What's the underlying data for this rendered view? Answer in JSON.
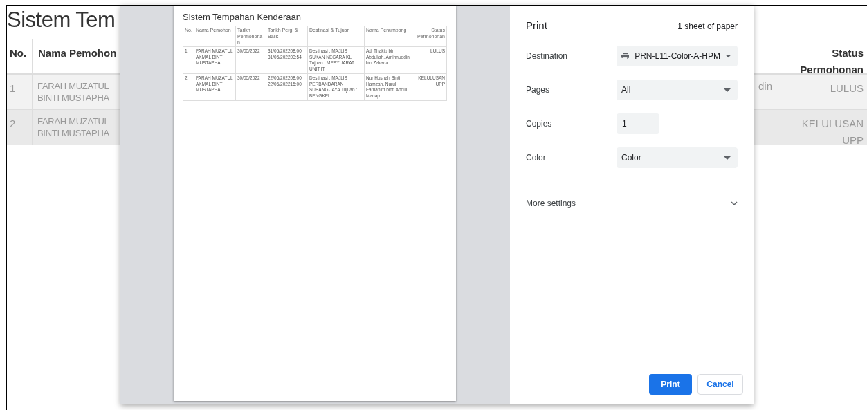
{
  "background": {
    "title": "Sistem Tem",
    "columns": [
      "No.",
      "Nama Pemohon",
      "Status Permohonan"
    ],
    "rows": [
      {
        "no": "1",
        "name": [
          "FARAH MUZATUL",
          "BINTI MUSTAPHA"
        ],
        "passenger": "din",
        "status": "LULUS"
      },
      {
        "no": "2",
        "name": [
          "FARAH MUZATUL",
          "BINTI MUSTAPHA"
        ],
        "status": "KELULUSAN UPP"
      }
    ]
  },
  "preview": {
    "title": "Sistem Tempahan Kenderaan",
    "columns": [
      "No.",
      "Nama Pemohon",
      "Tarikh Permohonan",
      "Tarikh Pergi & Balik",
      "Destinasi & Tujuan",
      "Nama Penumpang",
      "Status Permohonan"
    ],
    "rows": [
      [
        "1",
        "FARAH MUZATUL AKMAL BINTI MUSTAPHA",
        "30/05/2022",
        "31/05/202208:00 31/05/202203:54",
        "Destinasi : MAJLIS SUKAN NEGARA KL Tujuan : MESYUARAT UNIT IT",
        "Adi Thakib bin Abdullah, Aminnuddin bin Zakaria",
        "LULUS"
      ],
      [
        "2",
        "FARAH MUZATUL AKMAL BINTI MUSTAPHA",
        "30/05/2022",
        "22/06/202208:00 22/06/202215:00",
        "Destinasi : MAJLIS PERBANDARAN SUBANG JAYA Tujuan : BENGKEL",
        "Nur Husnah Binti Hamzah, Nurul Farhanim binti Abdul Manap",
        "KELULUSAN UPP"
      ]
    ]
  },
  "print_panel": {
    "title": "Print",
    "sheets": "1 sheet of paper",
    "settings": [
      {
        "kind": "printer_select",
        "label": "Destination",
        "value": "PRN-L11-Color-A-HPM"
      },
      {
        "kind": "select",
        "label": "Pages",
        "value": "All"
      },
      {
        "kind": "number",
        "label": "Copies",
        "value": "1"
      },
      {
        "kind": "select",
        "label": "Color",
        "value": "Color"
      }
    ],
    "more_settings": "More settings",
    "buttons": [
      {
        "kind": "primary",
        "label": "Print"
      },
      {
        "kind": "secondary",
        "label": "Cancel"
      }
    ]
  }
}
